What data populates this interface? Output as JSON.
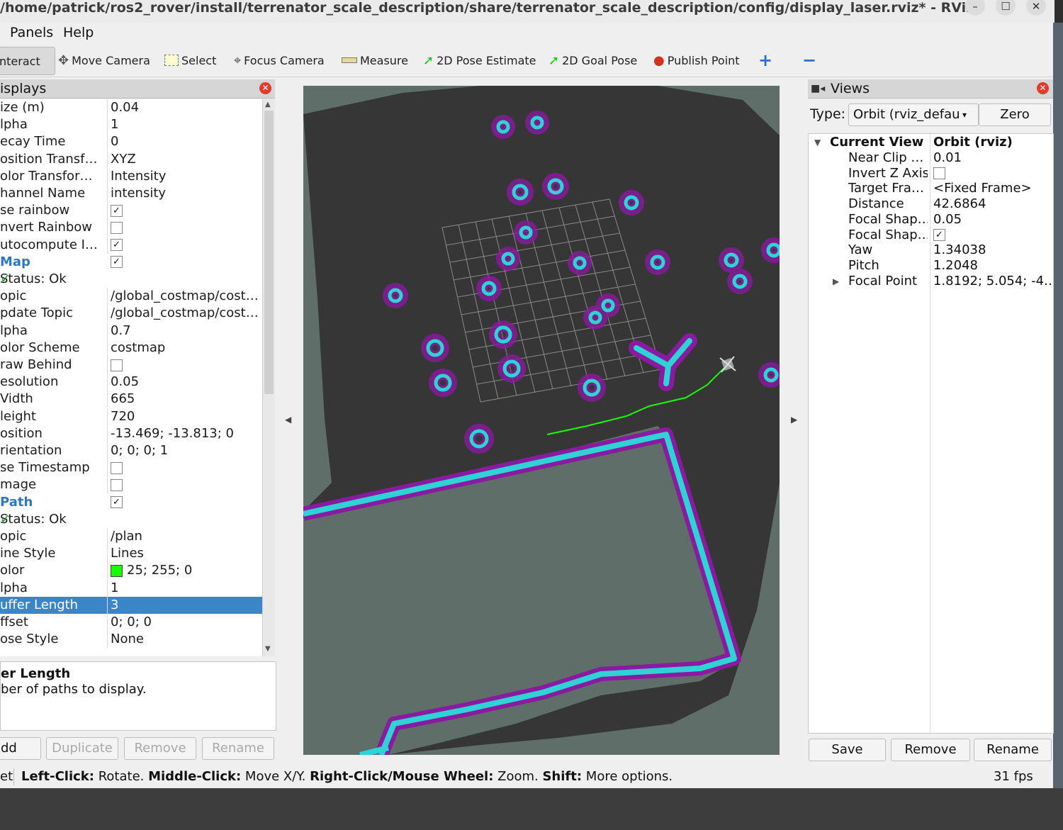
{
  "window": {
    "title": "/home/patrick/ros2_rover/install/terrenator_scale_description/share/terrenator_scale_description/config/display_laser.rviz* - RViz",
    "controls": [
      "–",
      "☐",
      "✕"
    ]
  },
  "menu": [
    "Panels",
    "Help"
  ],
  "toolbar": {
    "tools": [
      "nteract",
      "Move Camera",
      "Select",
      "Focus Camera",
      "Measure",
      "2D Pose Estimate",
      "2D Goal Pose",
      "Publish Point"
    ],
    "add_label": "+",
    "remove_label": "−",
    "active_tool": "nteract"
  },
  "displays": {
    "title": "isplays",
    "rows": [
      {
        "key": "ize (m)",
        "value": "0.04"
      },
      {
        "key": "lpha",
        "value": "1"
      },
      {
        "key": "ecay Time",
        "value": "0"
      },
      {
        "key": "osition Transf…",
        "value": "XYZ"
      },
      {
        "key": "olor Transfor…",
        "value": "Intensity"
      },
      {
        "key": "hannel Name",
        "value": "intensity"
      },
      {
        "key": "se rainbow",
        "value": "",
        "check": true
      },
      {
        "key": "nvert Rainbow",
        "value": "",
        "check": false
      },
      {
        "key": "utocompute I…",
        "value": "",
        "check": true
      },
      {
        "key": "Map",
        "value": "",
        "check": true,
        "header": true
      },
      {
        "key": "   Status: Ok",
        "value": "",
        "status": true
      },
      {
        "key": "opic",
        "value": "/global_costmap/cost…"
      },
      {
        "key": "pdate Topic",
        "value": "/global_costmap/cost…"
      },
      {
        "key": "lpha",
        "value": "0.7"
      },
      {
        "key": "olor Scheme",
        "value": "costmap"
      },
      {
        "key": "raw Behind",
        "value": "",
        "check": false
      },
      {
        "key": "esolution",
        "value": "0.05"
      },
      {
        "key": "Vidth",
        "value": "665"
      },
      {
        "key": "leight",
        "value": "720"
      },
      {
        "key": "osition",
        "value": "-13.469; -13.813; 0"
      },
      {
        "key": "rientation",
        "value": "0; 0; 0; 1"
      },
      {
        "key": "se Timestamp",
        "value": "",
        "check": false
      },
      {
        "key": "mage",
        "value": "",
        "check": false
      },
      {
        "key": "Path",
        "value": "",
        "check": true,
        "header": true
      },
      {
        "key": "   Status: Ok",
        "value": "",
        "status": true
      },
      {
        "key": "opic",
        "value": "/plan"
      },
      {
        "key": "ine Style",
        "value": "Lines"
      },
      {
        "key": "olor",
        "value": "25; 255; 0",
        "swatch": "#19ff00"
      },
      {
        "key": "lpha",
        "value": "1"
      },
      {
        "key": "uffer Length",
        "value": "3",
        "selected": true
      },
      {
        "key": "ffset",
        "value": "0; 0; 0"
      },
      {
        "key": "ose Style",
        "value": "None"
      }
    ],
    "desc_title": "er Length",
    "desc_text": "ber of paths to display.",
    "buttons": [
      "dd",
      "Duplicate",
      "Remove",
      "Rename"
    ]
  },
  "views": {
    "title": "Views",
    "type_label": "Type:",
    "type_value": "Orbit (rviz_defau",
    "zero_label": "Zero",
    "header_key": "Current View",
    "header_value": "Orbit (rviz)",
    "rows": [
      {
        "key": "Near Clip …",
        "value": "0.01"
      },
      {
        "key": "Invert Z Axis",
        "value": "",
        "check": false
      },
      {
        "key": "Target Fra…",
        "value": "<Fixed Frame>"
      },
      {
        "key": "Distance",
        "value": "42.6864"
      },
      {
        "key": "Focal Shap…",
        "value": "0.05"
      },
      {
        "key": "Focal Shap…",
        "value": "",
        "check": true
      },
      {
        "key": "Yaw",
        "value": "1.34038"
      },
      {
        "key": "Pitch",
        "value": "1.2048"
      },
      {
        "key": "Focal Point",
        "value": "1.8192; 5.054; -4…",
        "expandable": true
      }
    ],
    "buttons": [
      "Save",
      "Remove",
      "Rename"
    ]
  },
  "statusbar": {
    "prefix": "et",
    "parts": [
      {
        "b": "Left-Click:",
        "t": " Rotate. "
      },
      {
        "b": "Middle-Click:",
        "t": " Move X/Y. "
      },
      {
        "b": "Right-Click/Mouse Wheel:",
        "t": " Zoom. "
      },
      {
        "b": "Shift:",
        "t": " More options."
      }
    ],
    "fps": "31 fps"
  },
  "colors": {
    "map_free": "#5f6e69",
    "map_unknown": "#363636",
    "obstacle_cyan": "#2fd3d6",
    "inflation_magenta": "#8a1aa0",
    "path_green": "#19ff00",
    "selection_blue": "#3a86c8"
  }
}
